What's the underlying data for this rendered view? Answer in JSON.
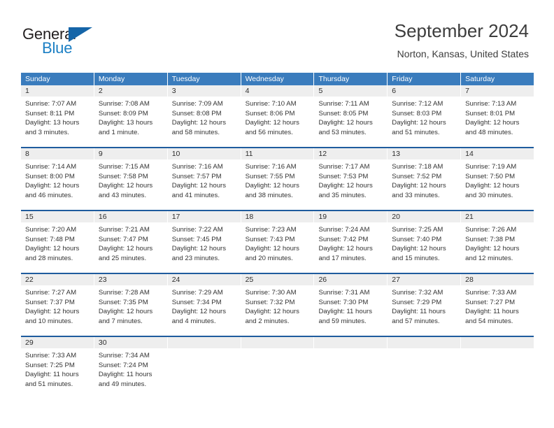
{
  "brand": {
    "word_one": "General",
    "word_two": "Blue"
  },
  "header": {
    "title": "September 2024",
    "location": "Norton, Kansas, United States"
  },
  "colors": {
    "header_blue": "#3a7cbd",
    "separator_blue": "#1f5c9e",
    "day_band": "#eeeeee",
    "brand_blue": "#1b7fc4",
    "brand_dark": "#231f20"
  },
  "weekdays": [
    "Sunday",
    "Monday",
    "Tuesday",
    "Wednesday",
    "Thursday",
    "Friday",
    "Saturday"
  ],
  "weeks": [
    [
      {
        "day": "1",
        "sunrise": "Sunrise: 7:07 AM",
        "sunset": "Sunset: 8:11 PM",
        "daylight_1": "Daylight: 13 hours",
        "daylight_2": "and 3 minutes."
      },
      {
        "day": "2",
        "sunrise": "Sunrise: 7:08 AM",
        "sunset": "Sunset: 8:09 PM",
        "daylight_1": "Daylight: 13 hours",
        "daylight_2": "and 1 minute."
      },
      {
        "day": "3",
        "sunrise": "Sunrise: 7:09 AM",
        "sunset": "Sunset: 8:08 PM",
        "daylight_1": "Daylight: 12 hours",
        "daylight_2": "and 58 minutes."
      },
      {
        "day": "4",
        "sunrise": "Sunrise: 7:10 AM",
        "sunset": "Sunset: 8:06 PM",
        "daylight_1": "Daylight: 12 hours",
        "daylight_2": "and 56 minutes."
      },
      {
        "day": "5",
        "sunrise": "Sunrise: 7:11 AM",
        "sunset": "Sunset: 8:05 PM",
        "daylight_1": "Daylight: 12 hours",
        "daylight_2": "and 53 minutes."
      },
      {
        "day": "6",
        "sunrise": "Sunrise: 7:12 AM",
        "sunset": "Sunset: 8:03 PM",
        "daylight_1": "Daylight: 12 hours",
        "daylight_2": "and 51 minutes."
      },
      {
        "day": "7",
        "sunrise": "Sunrise: 7:13 AM",
        "sunset": "Sunset: 8:01 PM",
        "daylight_1": "Daylight: 12 hours",
        "daylight_2": "and 48 minutes."
      }
    ],
    [
      {
        "day": "8",
        "sunrise": "Sunrise: 7:14 AM",
        "sunset": "Sunset: 8:00 PM",
        "daylight_1": "Daylight: 12 hours",
        "daylight_2": "and 46 minutes."
      },
      {
        "day": "9",
        "sunrise": "Sunrise: 7:15 AM",
        "sunset": "Sunset: 7:58 PM",
        "daylight_1": "Daylight: 12 hours",
        "daylight_2": "and 43 minutes."
      },
      {
        "day": "10",
        "sunrise": "Sunrise: 7:16 AM",
        "sunset": "Sunset: 7:57 PM",
        "daylight_1": "Daylight: 12 hours",
        "daylight_2": "and 41 minutes."
      },
      {
        "day": "11",
        "sunrise": "Sunrise: 7:16 AM",
        "sunset": "Sunset: 7:55 PM",
        "daylight_1": "Daylight: 12 hours",
        "daylight_2": "and 38 minutes."
      },
      {
        "day": "12",
        "sunrise": "Sunrise: 7:17 AM",
        "sunset": "Sunset: 7:53 PM",
        "daylight_1": "Daylight: 12 hours",
        "daylight_2": "and 35 minutes."
      },
      {
        "day": "13",
        "sunrise": "Sunrise: 7:18 AM",
        "sunset": "Sunset: 7:52 PM",
        "daylight_1": "Daylight: 12 hours",
        "daylight_2": "and 33 minutes."
      },
      {
        "day": "14",
        "sunrise": "Sunrise: 7:19 AM",
        "sunset": "Sunset: 7:50 PM",
        "daylight_1": "Daylight: 12 hours",
        "daylight_2": "and 30 minutes."
      }
    ],
    [
      {
        "day": "15",
        "sunrise": "Sunrise: 7:20 AM",
        "sunset": "Sunset: 7:48 PM",
        "daylight_1": "Daylight: 12 hours",
        "daylight_2": "and 28 minutes."
      },
      {
        "day": "16",
        "sunrise": "Sunrise: 7:21 AM",
        "sunset": "Sunset: 7:47 PM",
        "daylight_1": "Daylight: 12 hours",
        "daylight_2": "and 25 minutes."
      },
      {
        "day": "17",
        "sunrise": "Sunrise: 7:22 AM",
        "sunset": "Sunset: 7:45 PM",
        "daylight_1": "Daylight: 12 hours",
        "daylight_2": "and 23 minutes."
      },
      {
        "day": "18",
        "sunrise": "Sunrise: 7:23 AM",
        "sunset": "Sunset: 7:43 PM",
        "daylight_1": "Daylight: 12 hours",
        "daylight_2": "and 20 minutes."
      },
      {
        "day": "19",
        "sunrise": "Sunrise: 7:24 AM",
        "sunset": "Sunset: 7:42 PM",
        "daylight_1": "Daylight: 12 hours",
        "daylight_2": "and 17 minutes."
      },
      {
        "day": "20",
        "sunrise": "Sunrise: 7:25 AM",
        "sunset": "Sunset: 7:40 PM",
        "daylight_1": "Daylight: 12 hours",
        "daylight_2": "and 15 minutes."
      },
      {
        "day": "21",
        "sunrise": "Sunrise: 7:26 AM",
        "sunset": "Sunset: 7:38 PM",
        "daylight_1": "Daylight: 12 hours",
        "daylight_2": "and 12 minutes."
      }
    ],
    [
      {
        "day": "22",
        "sunrise": "Sunrise: 7:27 AM",
        "sunset": "Sunset: 7:37 PM",
        "daylight_1": "Daylight: 12 hours",
        "daylight_2": "and 10 minutes."
      },
      {
        "day": "23",
        "sunrise": "Sunrise: 7:28 AM",
        "sunset": "Sunset: 7:35 PM",
        "daylight_1": "Daylight: 12 hours",
        "daylight_2": "and 7 minutes."
      },
      {
        "day": "24",
        "sunrise": "Sunrise: 7:29 AM",
        "sunset": "Sunset: 7:34 PM",
        "daylight_1": "Daylight: 12 hours",
        "daylight_2": "and 4 minutes."
      },
      {
        "day": "25",
        "sunrise": "Sunrise: 7:30 AM",
        "sunset": "Sunset: 7:32 PM",
        "daylight_1": "Daylight: 12 hours",
        "daylight_2": "and 2 minutes."
      },
      {
        "day": "26",
        "sunrise": "Sunrise: 7:31 AM",
        "sunset": "Sunset: 7:30 PM",
        "daylight_1": "Daylight: 11 hours",
        "daylight_2": "and 59 minutes."
      },
      {
        "day": "27",
        "sunrise": "Sunrise: 7:32 AM",
        "sunset": "Sunset: 7:29 PM",
        "daylight_1": "Daylight: 11 hours",
        "daylight_2": "and 57 minutes."
      },
      {
        "day": "28",
        "sunrise": "Sunrise: 7:33 AM",
        "sunset": "Sunset: 7:27 PM",
        "daylight_1": "Daylight: 11 hours",
        "daylight_2": "and 54 minutes."
      }
    ],
    [
      {
        "day": "29",
        "sunrise": "Sunrise: 7:33 AM",
        "sunset": "Sunset: 7:25 PM",
        "daylight_1": "Daylight: 11 hours",
        "daylight_2": "and 51 minutes."
      },
      {
        "day": "30",
        "sunrise": "Sunrise: 7:34 AM",
        "sunset": "Sunset: 7:24 PM",
        "daylight_1": "Daylight: 11 hours",
        "daylight_2": "and 49 minutes."
      },
      {
        "day": "",
        "sunrise": "",
        "sunset": "",
        "daylight_1": "",
        "daylight_2": ""
      },
      {
        "day": "",
        "sunrise": "",
        "sunset": "",
        "daylight_1": "",
        "daylight_2": ""
      },
      {
        "day": "",
        "sunrise": "",
        "sunset": "",
        "daylight_1": "",
        "daylight_2": ""
      },
      {
        "day": "",
        "sunrise": "",
        "sunset": "",
        "daylight_1": "",
        "daylight_2": ""
      },
      {
        "day": "",
        "sunrise": "",
        "sunset": "",
        "daylight_1": "",
        "daylight_2": ""
      }
    ]
  ]
}
